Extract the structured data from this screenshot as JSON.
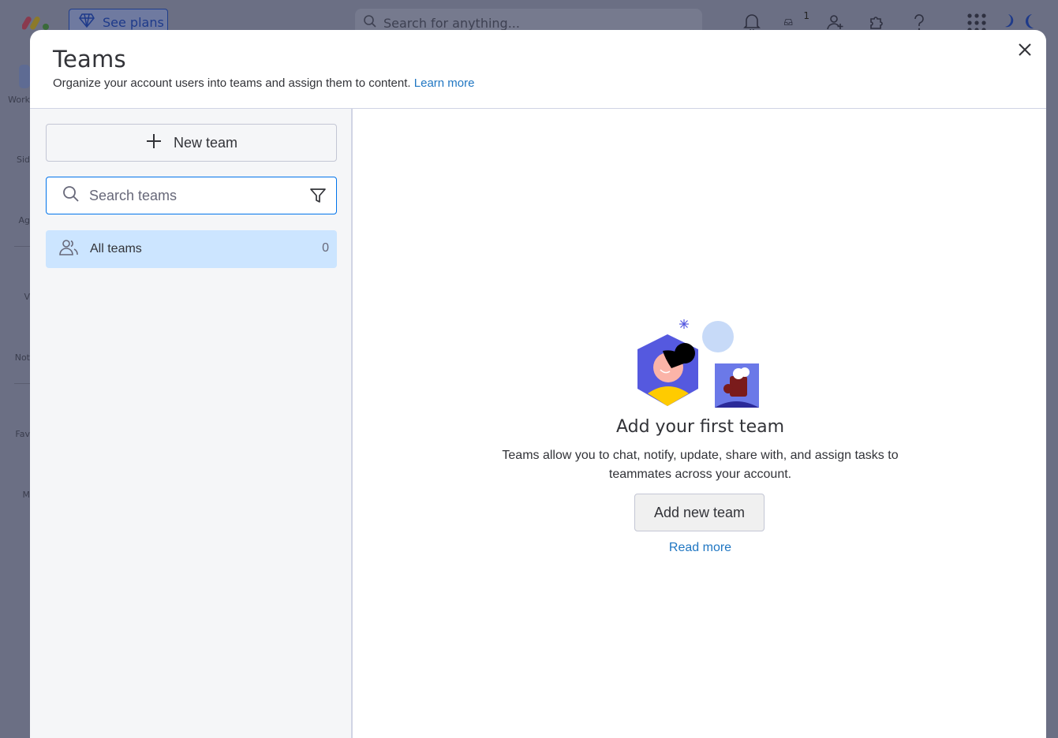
{
  "background": {
    "see_plans_label": "See plans",
    "search_placeholder": "Search for anything...",
    "inbox_badge": "1",
    "rail_items": [
      "Work",
      "Sid",
      "Ag",
      "V",
      "Not",
      "Fav",
      "M"
    ]
  },
  "modal": {
    "title": "Teams",
    "subtitle": "Organize your account users into teams and assign them to content.",
    "learn_more": "Learn more"
  },
  "sidebar": {
    "new_team_label": "New team",
    "search_placeholder": "Search teams",
    "all_teams": {
      "label": "All teams",
      "count": "0"
    }
  },
  "empty_state": {
    "title": "Add your first team",
    "description": "Teams allow you to chat, notify, update, share with, and assign tasks to teammates across your account.",
    "add_button": "Add new team",
    "read_more": "Read more"
  },
  "colors": {
    "accent": "#0073ea",
    "link": "#1f76c2",
    "selected_bg": "#cce5ff",
    "overlay": "#6b6f84"
  }
}
